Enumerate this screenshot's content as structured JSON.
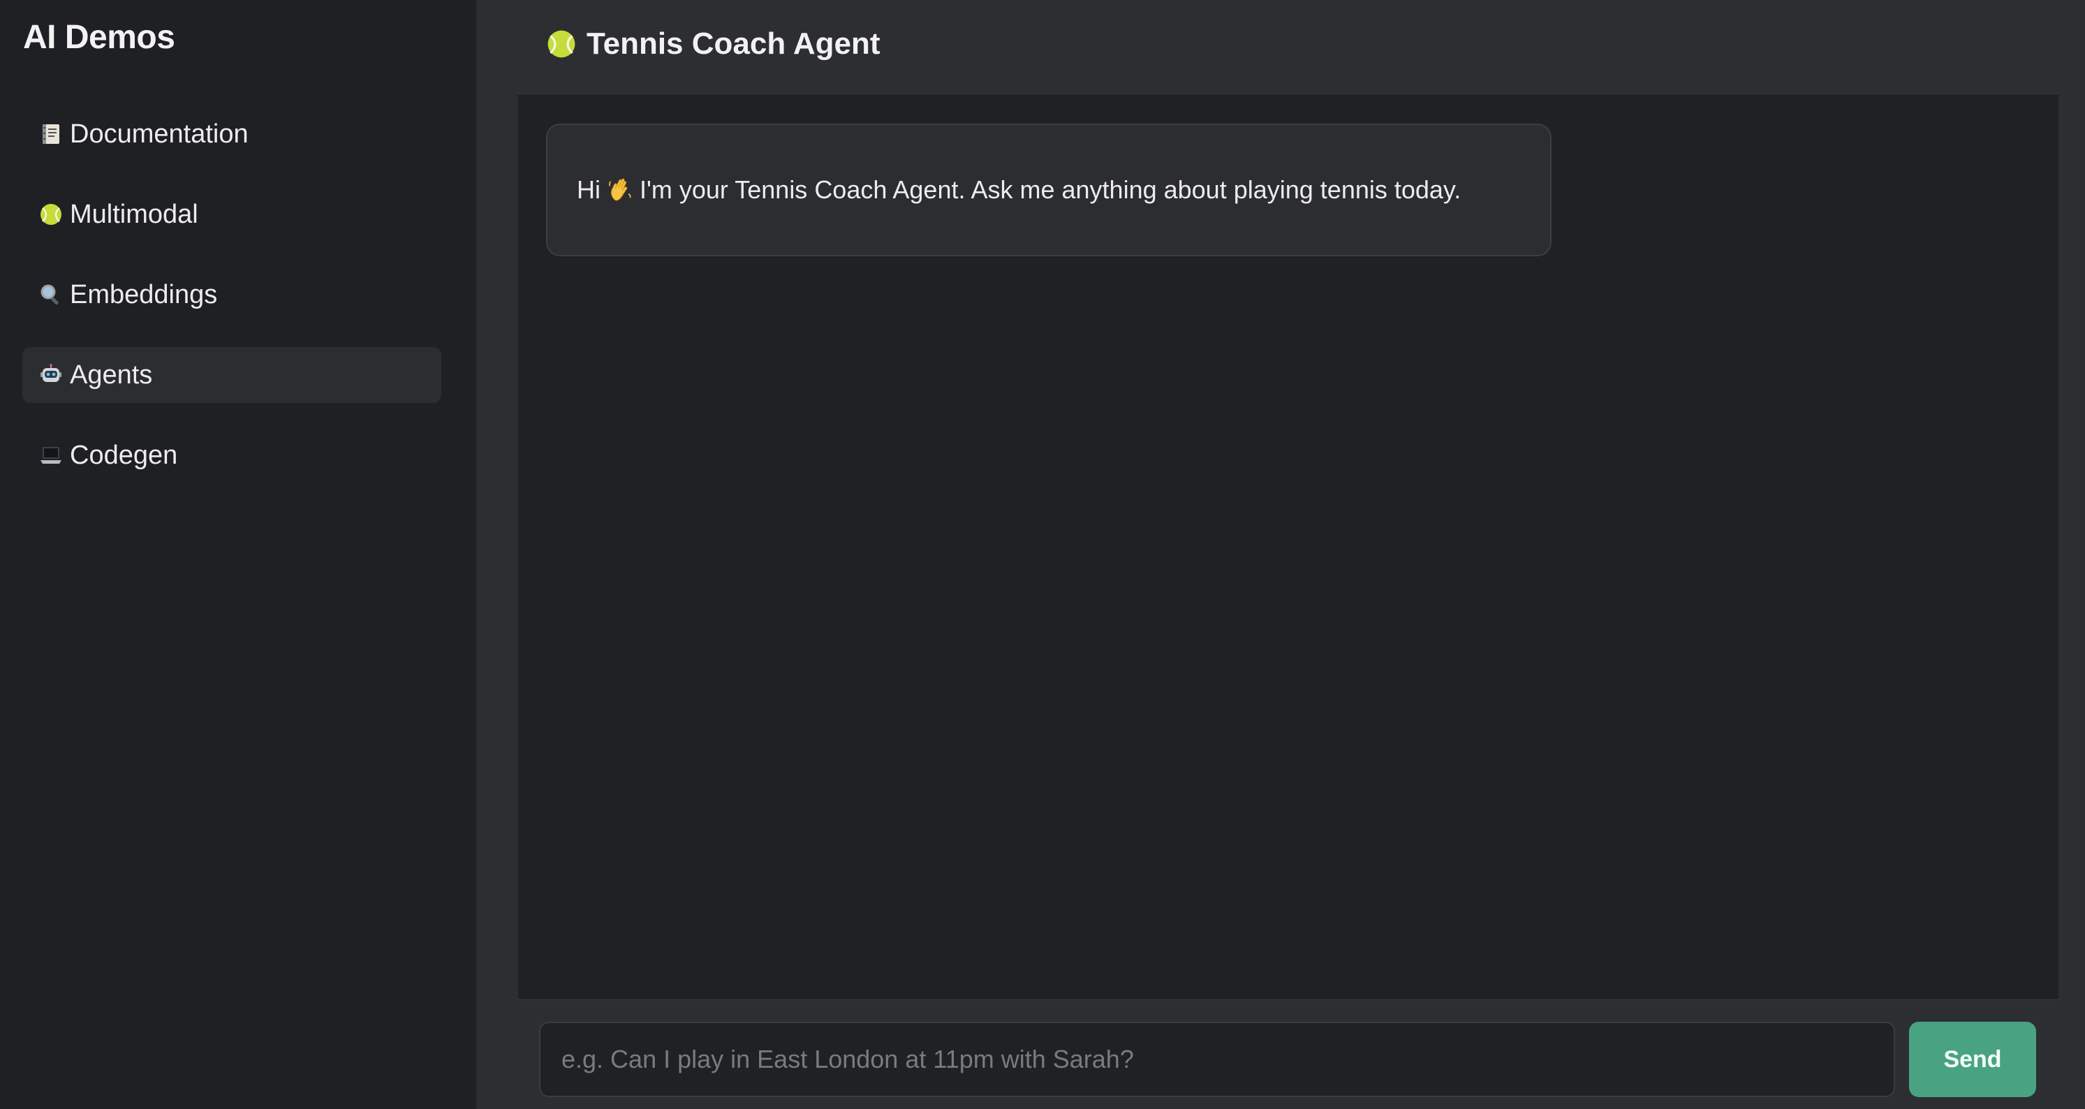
{
  "sidebar": {
    "title": "AI Demos",
    "items": [
      {
        "label": "Documentation",
        "icon": "notebook-icon",
        "active": false
      },
      {
        "label": "Multimodal",
        "icon": "tennis-ball-icon",
        "active": false
      },
      {
        "label": "Embeddings",
        "icon": "magnifier-icon",
        "active": false
      },
      {
        "label": "Agents",
        "icon": "robot-icon",
        "active": true
      },
      {
        "label": "Codegen",
        "icon": "laptop-icon",
        "active": false
      }
    ]
  },
  "header": {
    "title": "Tennis Coach Agent",
    "icon": "tennis-ball-icon"
  },
  "chat": {
    "messages": [
      {
        "role": "assistant",
        "prefix": "Hi",
        "icon": "waving-hand-icon",
        "text": "I'm your Tennis Coach Agent. Ask me anything about playing tennis today."
      }
    ]
  },
  "composer": {
    "placeholder": "e.g. Can I play in East London at 11pm with Sarah?",
    "value": "",
    "send_label": "Send"
  },
  "colors": {
    "sidebar_bg": "#1f2023",
    "main_bg": "#2d2e31",
    "chat_bg": "#202123",
    "accent": "#49a383"
  }
}
